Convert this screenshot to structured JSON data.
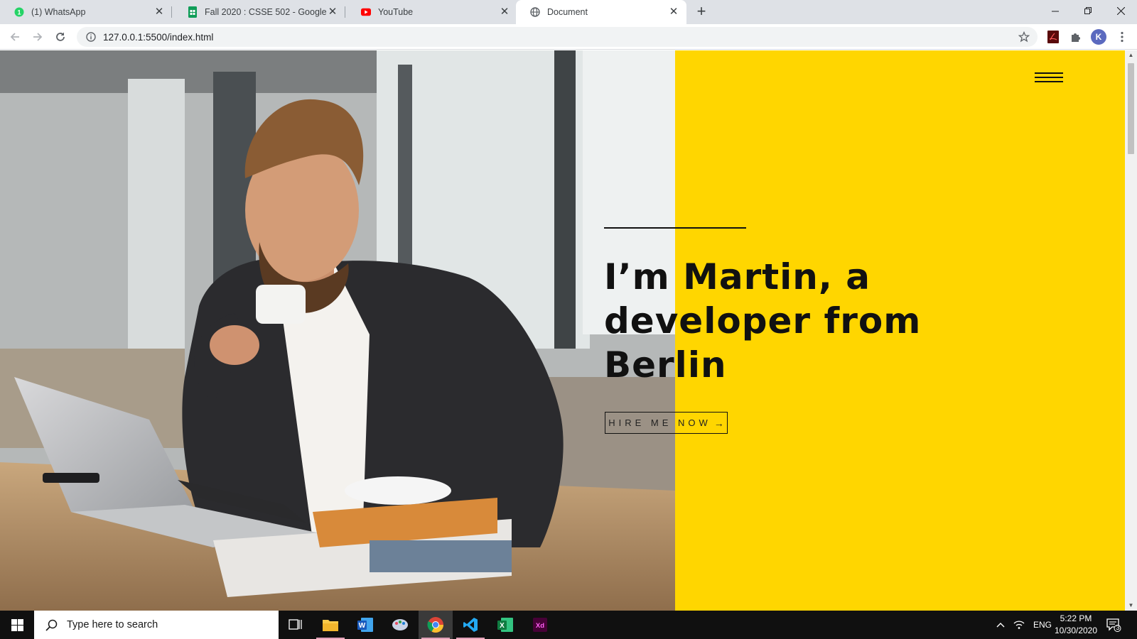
{
  "browser": {
    "tabs": [
      {
        "title": "(1) WhatsApp",
        "icon": "whatsapp-icon",
        "active": false
      },
      {
        "title": "Fall 2020 : CSSE 502 - Google Sh",
        "icon": "google-sheets-icon",
        "active": false
      },
      {
        "title": "YouTube",
        "icon": "youtube-icon",
        "active": false
      },
      {
        "title": "Document",
        "icon": "globe-icon",
        "active": true
      }
    ],
    "address": "127.0.0.1:5500/index.html",
    "profile_initial": "K"
  },
  "page": {
    "hero_title_lines": [
      "I’m Martin, a",
      "developer from",
      "Berlin"
    ],
    "hire_button": "HIRE ME NOW",
    "hire_arrow": "→",
    "accent_color": "#ffd600"
  },
  "taskbar": {
    "search_placeholder": "Type here to search",
    "language": "ENG",
    "time": "5:22 PM",
    "date": "10/30/2020",
    "notification_count": "3",
    "apps": [
      "task-view",
      "file-explorer",
      "word",
      "paint-app",
      "chrome",
      "vs-code",
      "excel",
      "adobe-xd"
    ]
  }
}
